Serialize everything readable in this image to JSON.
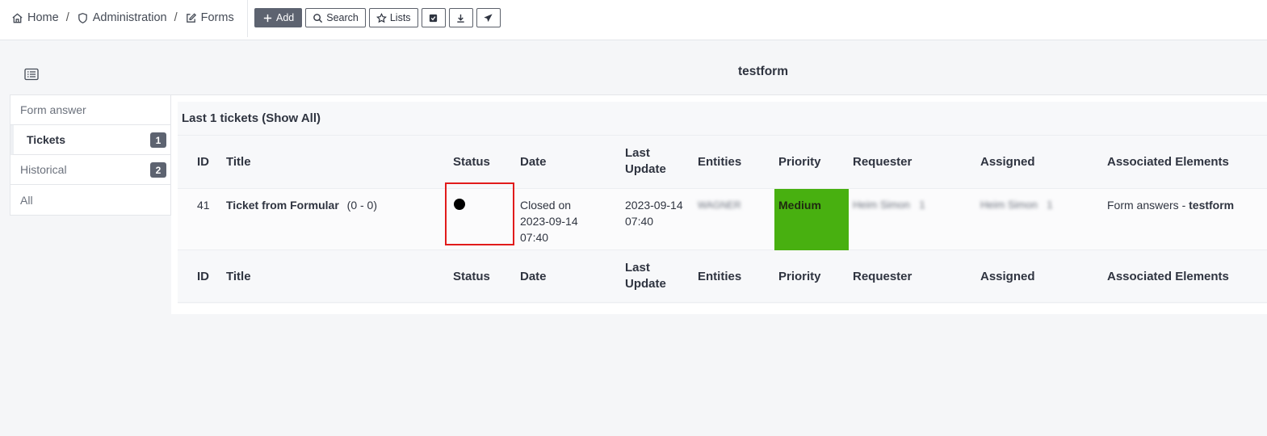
{
  "breadcrumb": {
    "home": "Home",
    "sep1": "/",
    "administration": "Administration",
    "sep2": "/",
    "forms": "Forms"
  },
  "toolbar": {
    "add_label": "Add",
    "search_label": "Search",
    "lists_label": "Lists"
  },
  "page": {
    "title": "testform"
  },
  "sidebar": {
    "items": [
      {
        "label": "Form answer",
        "badge": ""
      },
      {
        "label": "Tickets",
        "badge": "1"
      },
      {
        "label": "Historical",
        "badge": "2"
      },
      {
        "label": "All",
        "badge": ""
      }
    ]
  },
  "tickets": {
    "heading": "Last 1 tickets (Show All)",
    "columns": {
      "id": "ID",
      "title": "Title",
      "status": "Status",
      "date": "Date",
      "last_update_1": "Last",
      "last_update_2": "Update",
      "entities": "Entities",
      "priority": "Priority",
      "requester": "Requester",
      "assigned": "Assigned",
      "associated": "Associated Elements"
    },
    "row": {
      "id": "41",
      "title": "Ticket from Formular",
      "title_counts": "(0 - 0)",
      "date_line1": "Closed on",
      "date_line2": "2023-09-14",
      "date_line3": "07:40",
      "last_update_line1": "2023-09-14",
      "last_update_line2": "07:40",
      "entities": "WAGNER",
      "priority": "Medium",
      "priority_color": "#48b010",
      "requester": "Heim Simon",
      "requester_count": "1",
      "assigned": "Heim Simon",
      "assigned_count": "1",
      "associated_prefix": "Form answers - ",
      "associated_link": "testform"
    }
  },
  "colors": {
    "accent": "#5d6370",
    "highlight": "#e11b1b"
  }
}
